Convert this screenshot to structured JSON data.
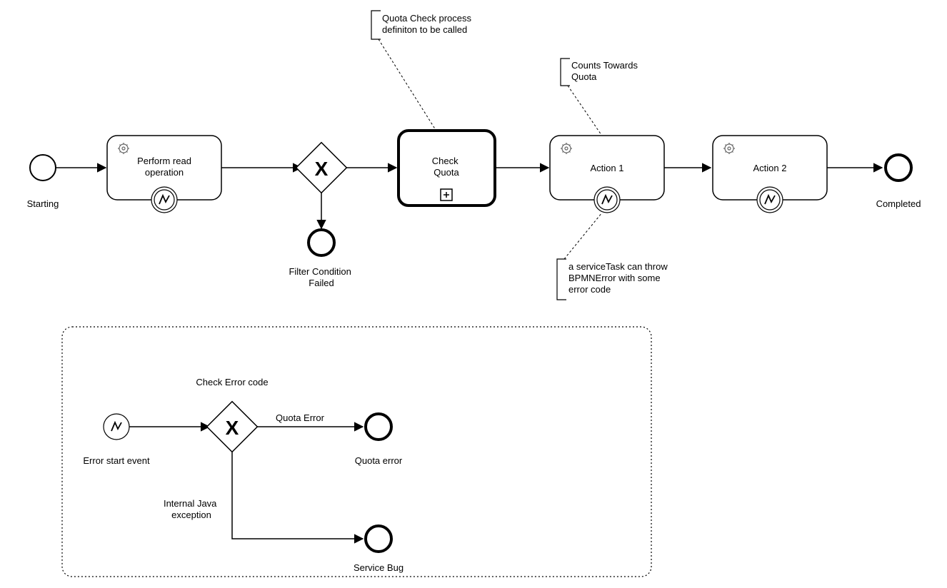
{
  "events": {
    "start": {
      "label": "Starting"
    },
    "completed": {
      "label": "Completed"
    },
    "filterFail": {
      "label": "Filter Condition\nFailed"
    },
    "quotaError": {
      "label": "Quota error"
    },
    "serviceBug": {
      "label": "Service Bug"
    },
    "errorStart": {
      "label": "Error start event"
    }
  },
  "tasks": {
    "performRead": {
      "label": "Perform read\noperation"
    },
    "checkQuota": {
      "label": "Check\nQuota"
    },
    "action1": {
      "label": "Action 1"
    },
    "action2": {
      "label": "Action 2"
    }
  },
  "gateways": {
    "main": {
      "symbol": "X"
    },
    "error": {
      "symbol": "X",
      "label": "Check Error code"
    }
  },
  "flows": {
    "quotaErrorFlow": "Quota Error",
    "javaExceptionFlow": "Internal Java\nexception"
  },
  "annotations": {
    "quotaCheckNote": "Quota Check process\ndefiniton to be called",
    "countsQuotaNote": "Counts Towards\nQuota",
    "serviceTaskNote": "a serviceTask can throw\nBPMNError with some\nerror code"
  }
}
